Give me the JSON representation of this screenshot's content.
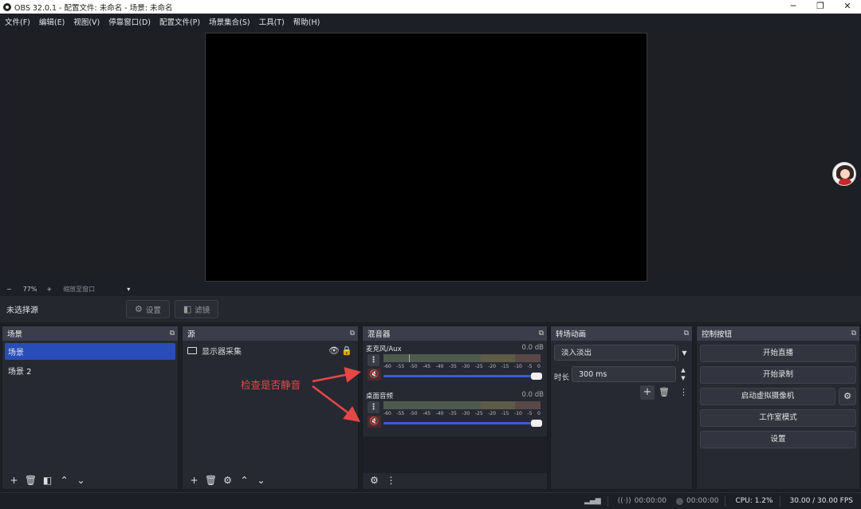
{
  "window": {
    "title": "OBS 32.0.1 - 配置文件: 未命名 - 场景: 未命名",
    "minimize": "─",
    "maximize": "❐",
    "close": "✕"
  },
  "menu": [
    "文件(F)",
    "编辑(E)",
    "视图(V)",
    "停靠窗口(D)",
    "配置文件(P)",
    "场景集合(S)",
    "工具(T)",
    "帮助(H)"
  ],
  "zoom": {
    "minus": "−",
    "level": "77%",
    "plus": "+",
    "fit": "缩放至窗口",
    "dropdown": "▾"
  },
  "context": {
    "no_source": "未选择源",
    "properties": "设置",
    "filters": "滤镜"
  },
  "docks": {
    "scenes": {
      "title": "场景",
      "items": [
        "场景",
        "场景 2"
      ],
      "active_index": 0
    },
    "sources": {
      "title": "源",
      "items": [
        {
          "name": "显示器采集",
          "visible": true,
          "locked": true
        }
      ]
    },
    "mixer": {
      "title": "混音器",
      "channels": [
        {
          "name": "麦克风/Aux",
          "db": "0.0 dB"
        },
        {
          "name": "桌面音频",
          "db": "0.0 dB"
        }
      ],
      "scale": [
        "-60",
        "-55",
        "-50",
        "-45",
        "-40",
        "-35",
        "-30",
        "-25",
        "-20",
        "-15",
        "-10",
        "-5",
        "0"
      ]
    },
    "transitions": {
      "title": "转场动画",
      "selected": "淡入淡出",
      "duration_label": "时长",
      "duration_value": "300 ms"
    },
    "controls": {
      "title": "控制按钮",
      "buttons": [
        "开始直播",
        "开始录制",
        "启动虚拟摄像机",
        "工作室模式",
        "设置"
      ]
    }
  },
  "annotation": "检查是否静音",
  "status": {
    "stream_time": "00:00:00",
    "rec_time": "00:00:00",
    "cpu": "CPU: 1.2%",
    "fps": "30.00 / 30.00 FPS"
  },
  "icons": [
    "obs-logo-icon",
    "eye-icon",
    "lock-icon",
    "mute-speaker-icon",
    "gear-icon",
    "plus-icon",
    "trash-icon",
    "filter-icon",
    "arrow-up-icon",
    "arrow-down-icon",
    "kebab-icon",
    "signal-icon",
    "record-dot-icon"
  ],
  "colors": {
    "accent": "#284cb8",
    "annotation": "#e84747",
    "mute": "#e53935",
    "slider": "#3a5bd6"
  }
}
